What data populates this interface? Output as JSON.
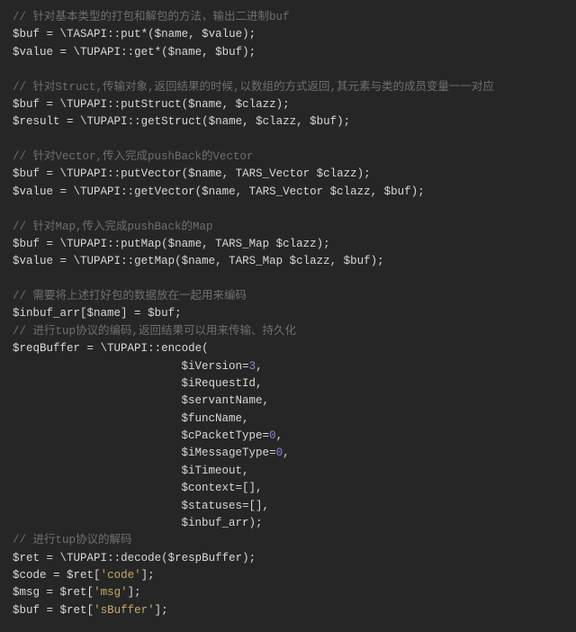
{
  "chart_data": null,
  "code": {
    "lines": [
      {
        "type": "comment",
        "text": "// 针对基本类型的打包和解包的方法，输出二进制buf"
      },
      {
        "type": "code",
        "tokens": [
          {
            "c": "var",
            "t": "$buf"
          },
          {
            "c": "pn",
            "t": " = "
          },
          {
            "c": "op",
            "t": "\\"
          },
          {
            "c": "cls",
            "t": "TASAPI"
          },
          {
            "c": "pn",
            "t": "::"
          },
          {
            "c": "pn",
            "t": "put*("
          },
          {
            "c": "var",
            "t": "$name"
          },
          {
            "c": "pn",
            "t": ", "
          },
          {
            "c": "var",
            "t": "$value"
          },
          {
            "c": "pn",
            "t": ");"
          }
        ]
      },
      {
        "type": "code",
        "tokens": [
          {
            "c": "var",
            "t": "$value"
          },
          {
            "c": "pn",
            "t": " = "
          },
          {
            "c": "op",
            "t": "\\"
          },
          {
            "c": "cls",
            "t": "TUPAPI"
          },
          {
            "c": "pn",
            "t": "::"
          },
          {
            "c": "pn",
            "t": "get*("
          },
          {
            "c": "var",
            "t": "$name"
          },
          {
            "c": "pn",
            "t": ", "
          },
          {
            "c": "var",
            "t": "$buf"
          },
          {
            "c": "pn",
            "t": ");"
          }
        ]
      },
      {
        "type": "blank"
      },
      {
        "type": "comment",
        "text": "// 针对Struct,传输对象,返回结果的时候,以数组的方式返回,其元素与类的成员变量一一对应"
      },
      {
        "type": "code",
        "tokens": [
          {
            "c": "var",
            "t": "$buf"
          },
          {
            "c": "pn",
            "t": " = "
          },
          {
            "c": "op",
            "t": "\\"
          },
          {
            "c": "cls",
            "t": "TUPAPI"
          },
          {
            "c": "pn",
            "t": "::"
          },
          {
            "c": "pn",
            "t": "putStruct("
          },
          {
            "c": "var",
            "t": "$name"
          },
          {
            "c": "pn",
            "t": ", "
          },
          {
            "c": "var",
            "t": "$clazz"
          },
          {
            "c": "pn",
            "t": ");"
          }
        ]
      },
      {
        "type": "code",
        "tokens": [
          {
            "c": "var",
            "t": "$result"
          },
          {
            "c": "pn",
            "t": " = "
          },
          {
            "c": "op",
            "t": "\\"
          },
          {
            "c": "cls",
            "t": "TUPAPI"
          },
          {
            "c": "pn",
            "t": "::"
          },
          {
            "c": "pn",
            "t": "getStruct("
          },
          {
            "c": "var",
            "t": "$name"
          },
          {
            "c": "pn",
            "t": ", "
          },
          {
            "c": "var",
            "t": "$clazz"
          },
          {
            "c": "pn",
            "t": ", "
          },
          {
            "c": "var",
            "t": "$buf"
          },
          {
            "c": "pn",
            "t": ");"
          }
        ]
      },
      {
        "type": "blank"
      },
      {
        "type": "comment",
        "text": "// 针对Vector,传入完成pushBack的Vector"
      },
      {
        "type": "code",
        "tokens": [
          {
            "c": "var",
            "t": "$buf"
          },
          {
            "c": "pn",
            "t": " = "
          },
          {
            "c": "op",
            "t": "\\"
          },
          {
            "c": "cls",
            "t": "TUPAPI"
          },
          {
            "c": "pn",
            "t": "::"
          },
          {
            "c": "pn",
            "t": "putVector("
          },
          {
            "c": "var",
            "t": "$name"
          },
          {
            "c": "pn",
            "t": ", TARS_Vector "
          },
          {
            "c": "var",
            "t": "$clazz"
          },
          {
            "c": "pn",
            "t": ");"
          }
        ]
      },
      {
        "type": "code",
        "tokens": [
          {
            "c": "var",
            "t": "$value"
          },
          {
            "c": "pn",
            "t": " = "
          },
          {
            "c": "op",
            "t": "\\"
          },
          {
            "c": "cls",
            "t": "TUPAPI"
          },
          {
            "c": "pn",
            "t": "::"
          },
          {
            "c": "pn",
            "t": "getVector("
          },
          {
            "c": "var",
            "t": "$name"
          },
          {
            "c": "pn",
            "t": ", TARS_Vector "
          },
          {
            "c": "var",
            "t": "$clazz"
          },
          {
            "c": "pn",
            "t": ", "
          },
          {
            "c": "var",
            "t": "$buf"
          },
          {
            "c": "pn",
            "t": ");"
          }
        ]
      },
      {
        "type": "blank"
      },
      {
        "type": "comment",
        "text": "// 针对Map,传入完成pushBack的Map"
      },
      {
        "type": "code",
        "tokens": [
          {
            "c": "var",
            "t": "$buf"
          },
          {
            "c": "pn",
            "t": " = "
          },
          {
            "c": "op",
            "t": "\\"
          },
          {
            "c": "cls",
            "t": "TUPAPI"
          },
          {
            "c": "pn",
            "t": "::"
          },
          {
            "c": "pn",
            "t": "putMap("
          },
          {
            "c": "var",
            "t": "$name"
          },
          {
            "c": "pn",
            "t": ", TARS_Map "
          },
          {
            "c": "var",
            "t": "$clazz"
          },
          {
            "c": "pn",
            "t": ");"
          }
        ]
      },
      {
        "type": "code",
        "tokens": [
          {
            "c": "var",
            "t": "$value"
          },
          {
            "c": "pn",
            "t": " = "
          },
          {
            "c": "op",
            "t": "\\"
          },
          {
            "c": "cls",
            "t": "TUPAPI"
          },
          {
            "c": "pn",
            "t": "::"
          },
          {
            "c": "pn",
            "t": "getMap("
          },
          {
            "c": "var",
            "t": "$name"
          },
          {
            "c": "pn",
            "t": ", TARS_Map "
          },
          {
            "c": "var",
            "t": "$clazz"
          },
          {
            "c": "pn",
            "t": ", "
          },
          {
            "c": "var",
            "t": "$buf"
          },
          {
            "c": "pn",
            "t": ");"
          }
        ]
      },
      {
        "type": "blank"
      },
      {
        "type": "comment",
        "text": "// 需要将上述打好包的数据放在一起用来编码"
      },
      {
        "type": "code",
        "tokens": [
          {
            "c": "var",
            "t": "$inbuf_arr"
          },
          {
            "c": "pn",
            "t": "["
          },
          {
            "c": "var",
            "t": "$name"
          },
          {
            "c": "pn",
            "t": "] = "
          },
          {
            "c": "var",
            "t": "$buf"
          },
          {
            "c": "pn",
            "t": ";"
          }
        ]
      },
      {
        "type": "comment",
        "text": "// 进行tup协议的编码,返回结果可以用来传输、持久化"
      },
      {
        "type": "code",
        "tokens": [
          {
            "c": "var",
            "t": "$reqBuffer"
          },
          {
            "c": "pn",
            "t": " = "
          },
          {
            "c": "op",
            "t": "\\"
          },
          {
            "c": "cls",
            "t": "TUPAPI"
          },
          {
            "c": "pn",
            "t": "::"
          },
          {
            "c": "pn",
            "t": "encode("
          }
        ]
      },
      {
        "type": "code",
        "tokens": [
          {
            "c": "pn",
            "t": "                         "
          },
          {
            "c": "var",
            "t": "$iVersion"
          },
          {
            "c": "pn",
            "t": "="
          },
          {
            "c": "num",
            "t": "3"
          },
          {
            "c": "pn",
            "t": ","
          }
        ]
      },
      {
        "type": "code",
        "tokens": [
          {
            "c": "pn",
            "t": "                         "
          },
          {
            "c": "var",
            "t": "$iRequestId"
          },
          {
            "c": "pn",
            "t": ","
          }
        ]
      },
      {
        "type": "code",
        "tokens": [
          {
            "c": "pn",
            "t": "                         "
          },
          {
            "c": "var",
            "t": "$servantName"
          },
          {
            "c": "pn",
            "t": ","
          }
        ]
      },
      {
        "type": "code",
        "tokens": [
          {
            "c": "pn",
            "t": "                         "
          },
          {
            "c": "var",
            "t": "$funcName"
          },
          {
            "c": "pn",
            "t": ","
          }
        ]
      },
      {
        "type": "code",
        "tokens": [
          {
            "c": "pn",
            "t": "                         "
          },
          {
            "c": "var",
            "t": "$cPacketType"
          },
          {
            "c": "pn",
            "t": "="
          },
          {
            "c": "num",
            "t": "0"
          },
          {
            "c": "pn",
            "t": ","
          }
        ]
      },
      {
        "type": "code",
        "tokens": [
          {
            "c": "pn",
            "t": "                         "
          },
          {
            "c": "var",
            "t": "$iMessageType"
          },
          {
            "c": "pn",
            "t": "="
          },
          {
            "c": "num",
            "t": "0"
          },
          {
            "c": "pn",
            "t": ","
          }
        ]
      },
      {
        "type": "code",
        "tokens": [
          {
            "c": "pn",
            "t": "                         "
          },
          {
            "c": "var",
            "t": "$iTimeout"
          },
          {
            "c": "pn",
            "t": ","
          }
        ]
      },
      {
        "type": "code",
        "tokens": [
          {
            "c": "pn",
            "t": "                         "
          },
          {
            "c": "var",
            "t": "$context"
          },
          {
            "c": "pn",
            "t": "=[],"
          }
        ]
      },
      {
        "type": "code",
        "tokens": [
          {
            "c": "pn",
            "t": "                         "
          },
          {
            "c": "var",
            "t": "$statuses"
          },
          {
            "c": "pn",
            "t": "=[],"
          }
        ]
      },
      {
        "type": "code",
        "tokens": [
          {
            "c": "pn",
            "t": "                         "
          },
          {
            "c": "var",
            "t": "$inbuf_arr"
          },
          {
            "c": "pn",
            "t": ");"
          }
        ]
      },
      {
        "type": "comment",
        "text": "// 进行tup协议的解码"
      },
      {
        "type": "code",
        "tokens": [
          {
            "c": "var",
            "t": "$ret"
          },
          {
            "c": "pn",
            "t": " = "
          },
          {
            "c": "op",
            "t": "\\"
          },
          {
            "c": "cls",
            "t": "TUPAPI"
          },
          {
            "c": "pn",
            "t": "::"
          },
          {
            "c": "pn",
            "t": "decode("
          },
          {
            "c": "var",
            "t": "$respBuffer"
          },
          {
            "c": "pn",
            "t": ");"
          }
        ]
      },
      {
        "type": "code",
        "tokens": [
          {
            "c": "var",
            "t": "$code"
          },
          {
            "c": "pn",
            "t": " = "
          },
          {
            "c": "var",
            "t": "$ret"
          },
          {
            "c": "pn",
            "t": "["
          },
          {
            "c": "str",
            "t": "'code'"
          },
          {
            "c": "pn",
            "t": "];"
          }
        ]
      },
      {
        "type": "code",
        "tokens": [
          {
            "c": "var",
            "t": "$msg"
          },
          {
            "c": "pn",
            "t": " = "
          },
          {
            "c": "var",
            "t": "$ret"
          },
          {
            "c": "pn",
            "t": "["
          },
          {
            "c": "str",
            "t": "'msg'"
          },
          {
            "c": "pn",
            "t": "];"
          }
        ]
      },
      {
        "type": "code",
        "tokens": [
          {
            "c": "var",
            "t": "$buf"
          },
          {
            "c": "pn",
            "t": " = "
          },
          {
            "c": "var",
            "t": "$ret"
          },
          {
            "c": "pn",
            "t": "["
          },
          {
            "c": "str",
            "t": "'sBuffer'"
          },
          {
            "c": "pn",
            "t": "];"
          }
        ]
      }
    ]
  }
}
